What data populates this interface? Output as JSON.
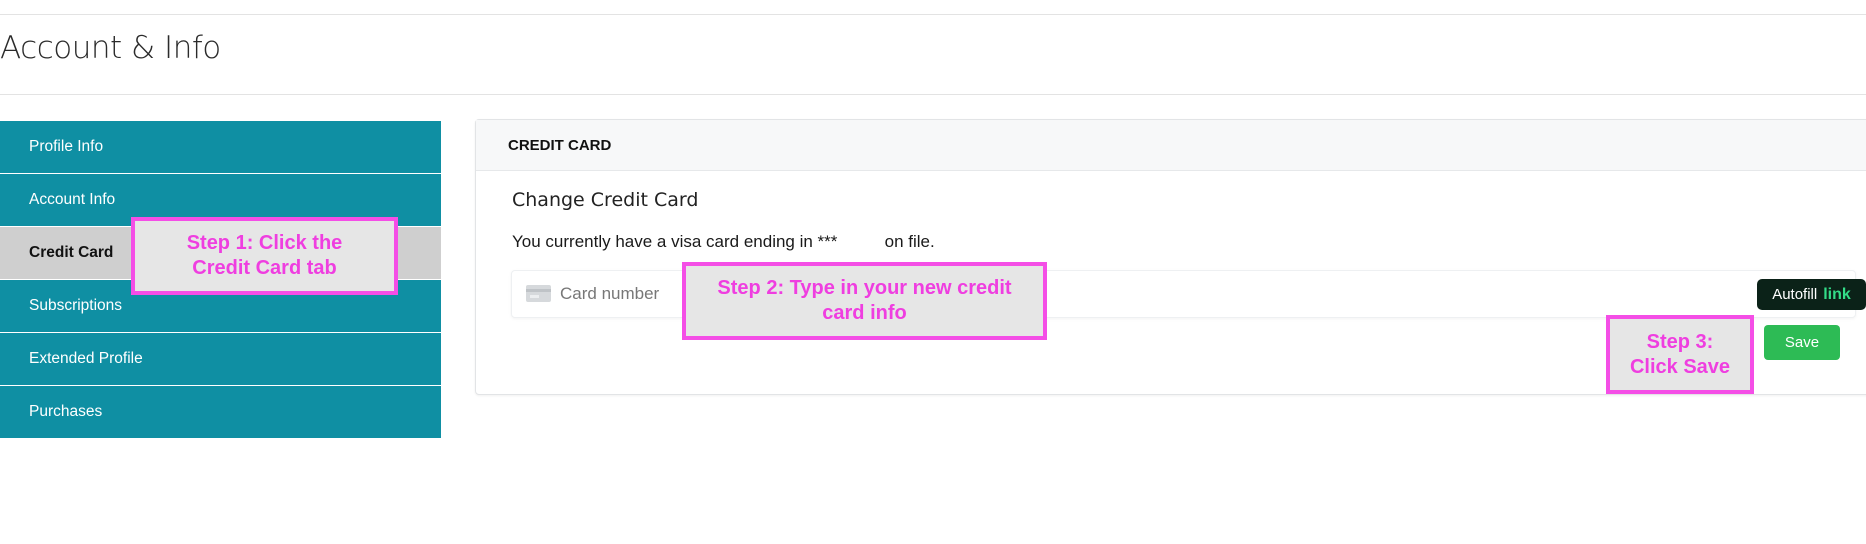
{
  "page": {
    "title": "Account & Info"
  },
  "sidebar": {
    "items": [
      {
        "label": "Profile Info"
      },
      {
        "label": "Account Info"
      },
      {
        "label": "Credit Card"
      },
      {
        "label": "Subscriptions"
      },
      {
        "label": "Extended Profile"
      },
      {
        "label": "Purchases"
      }
    ],
    "active": "Credit Card"
  },
  "panel": {
    "header": "CREDIT CARD",
    "subtitle": "Change Credit Card",
    "notice": "You currently have a visa card ending in ***          on file.",
    "card_field": {
      "placeholder": "Card number",
      "icon": "credit-card-icon"
    },
    "autofill": {
      "label": "Autofill",
      "link_word": "link"
    },
    "save_label": "Save"
  },
  "callouts": {
    "step1": "Step 1: Click the Credit Card tab",
    "step2": "Step 2: Type in your new credit card info",
    "step3": "Step 3: Click Save"
  },
  "colors": {
    "sidebar": "#0f8fa3",
    "sidebar_active": "#cfcfcf",
    "save": "#2dbb55",
    "callout_border": "#f44ee6",
    "callout_text": "#ef3ee0",
    "autofill_bg": "#0b2218",
    "autofill_link": "#33dd88"
  }
}
